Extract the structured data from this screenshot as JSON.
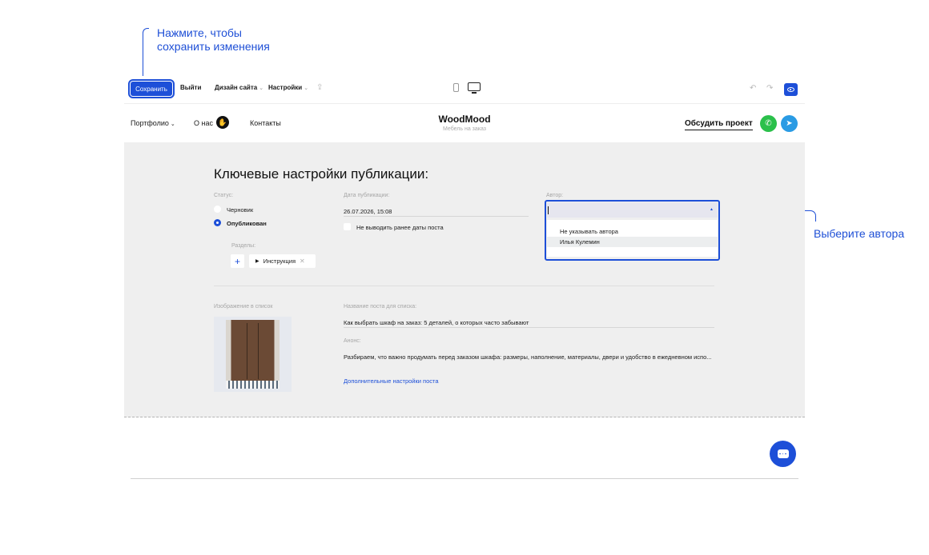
{
  "callouts": {
    "save_hint_line1": "Нажмите, чтобы",
    "save_hint_line2": "сохранить изменения",
    "author_hint": "Выберите автора"
  },
  "toolbar": {
    "save_label": "Сохранить",
    "exit_label": "Выйти",
    "design_label": "Дизайн сайта",
    "settings_label": "Настройки",
    "chevron": "⌄",
    "export_icon": "export-icon",
    "undo_icon": "undo-icon",
    "redo_icon": "redo-icon",
    "preview_icon": "eye-icon"
  },
  "site_header": {
    "nav": {
      "portfolio": "Портфолио",
      "about": "О нас",
      "contacts": "Контакты"
    },
    "brand": "WoodMood",
    "brand_sub": "Мебель на заказ",
    "cta": "Обсудить проект",
    "whatsapp_color": "#2bc04b",
    "telegram_color": "#2a9be4"
  },
  "settings": {
    "title": "Ключевые настройки публикации:",
    "status": {
      "label": "Статус:",
      "options": [
        "Черновик",
        "Опубликован"
      ],
      "selected": "Опубликован"
    },
    "publish_date": {
      "label": "Дата публикации:",
      "value": "26.07.2026, 15:08",
      "checkbox_label": "Не выводить ранее даты поста"
    },
    "author": {
      "label": "Автор:",
      "value": "",
      "options": [
        "Не указывать автора",
        "Илья Кулемин"
      ],
      "highlighted": "Илья Кулемин"
    },
    "sections": {
      "label": "Разделы:",
      "add": "+",
      "chips": [
        {
          "label": "Инструкция"
        }
      ]
    },
    "image": {
      "label": "Изображение в список"
    },
    "post_title": {
      "label": "Название поста для списка:",
      "value": "Как выбрать шкаф на заказ: 5 деталей, о которых часто забывают"
    },
    "announce": {
      "label": "Анонс:",
      "value": "Разбираем, что важно продумать перед заказом шкафа: размеры, наполнение, материалы, двери и удобство в ежедневном испо..."
    },
    "more_link": "Дополнительные настройки поста"
  },
  "accent_color": "#1d4fd8"
}
